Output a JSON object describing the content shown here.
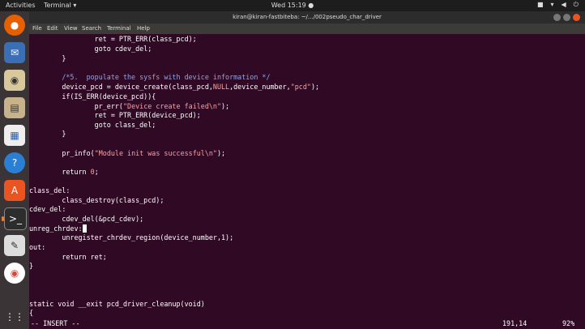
{
  "topbar": {
    "activities": "Activities",
    "app": "Terminal ▾",
    "clock": "Wed 15:19 ●"
  },
  "window": {
    "title": "kiran@kiran-fastbiteba: ~/.../002pseudo_char_driver"
  },
  "menu": [
    "File",
    "Edit",
    "View",
    "Search",
    "Terminal",
    "Help"
  ],
  "code": {
    "l1": "                ret = PTR_ERR(class_pcd);",
    "l2": "                goto cdev_del;",
    "l3": "        }",
    "l5": "        /*5.  populate the sysfs with device information */",
    "l6a": "        device_pcd = device_create(class_pcd,",
    "l6b": "NULL",
    "l6c": ",device_number,",
    "l6d": "\"pcd\"",
    "l6e": ");",
    "l7": "        if(IS_ERR(device_pcd)){",
    "l8a": "                pr_err(",
    "l8b": "\"Device create failed\\n\"",
    "l8c": ");",
    "l9": "                ret = PTR_ERR(device_pcd);",
    "l10": "                goto class_del;",
    "l11": "        }",
    "l13a": "        pr_info(",
    "l13b": "\"Module init was successful\\n\"",
    "l13c": ");",
    "l15a": "        return ",
    "l15b": "0",
    "l15c": ";",
    "l17": "class_del:",
    "l18": "        class_destroy(class_pcd);",
    "l19": "cdev_del:",
    "l20": "        cdev_del(&pcd_cdev);",
    "l21": "unreg_chrdev:",
    "l22": "        unregister_chrdev_region(device_number,1);",
    "l23": "out:",
    "l24": "        return ret;",
    "l25": "}",
    "l28": "static void __exit pcd_driver_cleanup(void)",
    "l29": "{"
  },
  "status": {
    "mode": "-- INSERT --",
    "position": "191,14",
    "percent": "92%"
  }
}
